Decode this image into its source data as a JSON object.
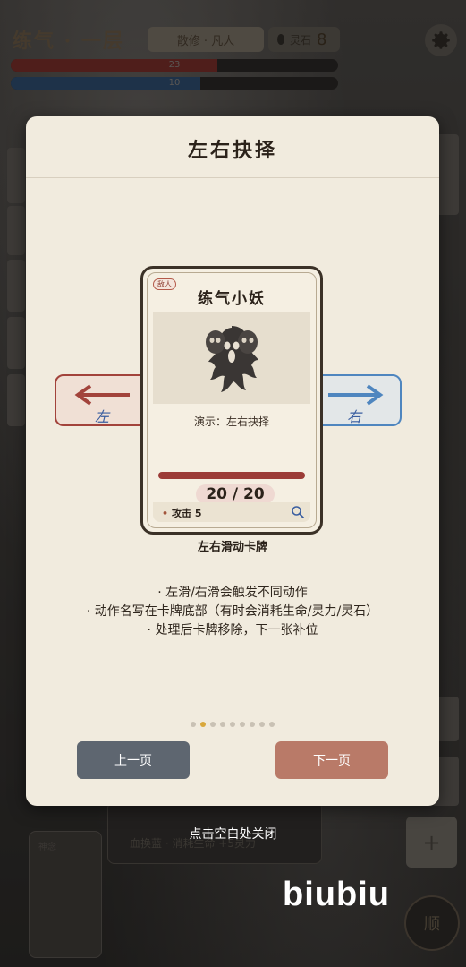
{
  "hud": {
    "realm": "练气 · 一层",
    "status_pill": "散修 · 凡人",
    "stone_label": "灵石",
    "stone_value": "8",
    "hp_text": "23",
    "hp_fraction": 0.63,
    "mp_text": "10",
    "mp_fraction": 0.58
  },
  "background": {
    "card_text": "血换蓝 · 消耗生命 +5灵力",
    "small_card_text": "神念",
    "plus_label": "+",
    "round_button_label": "顺"
  },
  "dialog": {
    "title": "左右抉择",
    "card": {
      "tag": "敌人",
      "name": "练气小妖",
      "caption": "演示：左右抉择",
      "hp": "20 / 20",
      "action": "攻击 5"
    },
    "left_label": "左",
    "right_label": "右",
    "under_card": "左右滑动卡牌",
    "tips": [
      "· 左滑/右滑会触发不同动作",
      "· 动作名写在卡牌底部（有时会消耗生命/灵力/灵石）",
      "· 处理后卡牌移除，下一张补位"
    ],
    "page_count": 9,
    "active_page": 1,
    "prev_label": "上一页",
    "next_label": "下一页"
  },
  "close_hint": "点击空白处关闭",
  "watermark": "biubiu"
}
